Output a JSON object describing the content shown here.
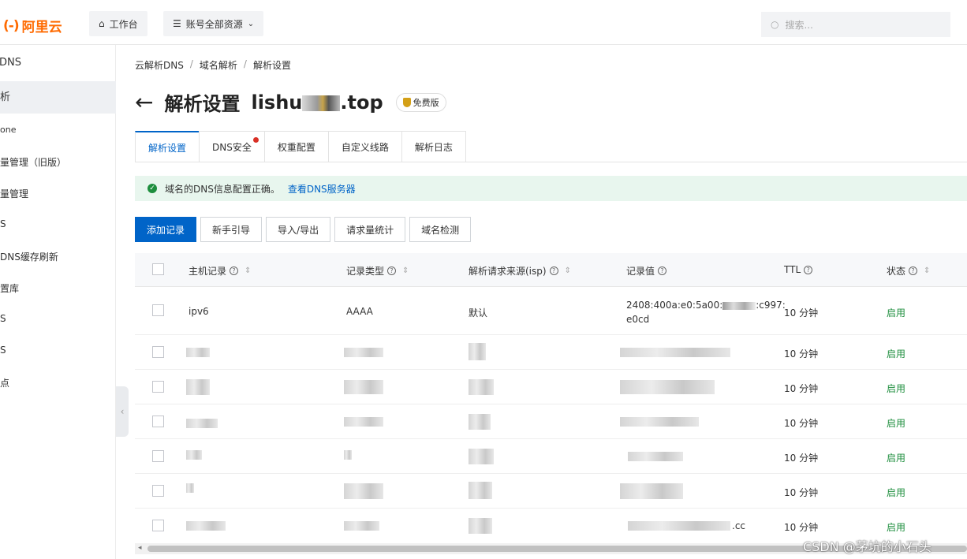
{
  "topbar": {
    "logo_mark": "(-)",
    "logo_text": "阿里云",
    "workbench_label": "工作台",
    "resources_label": "账号全部资源",
    "search_placeholder": "搜索..."
  },
  "sidebar": {
    "items": [
      {
        "label": "DNS"
      },
      {
        "label": "析"
      },
      {
        "label": "one"
      },
      {
        "label": "量管理（旧版）"
      },
      {
        "label": "量管理"
      },
      {
        "label": "S"
      },
      {
        "label": "DNS缓存刷新"
      },
      {
        "label": "置库"
      },
      {
        "label": "S"
      },
      {
        "label": "S"
      },
      {
        "label": "点"
      }
    ]
  },
  "breadcrumb": [
    "云解析DNS",
    "域名解析",
    "解析设置"
  ],
  "breadcrumb_sep": "/",
  "page": {
    "back_glyph": "←",
    "title": "解析设置",
    "domain_prefix": "lishu",
    "domain_suffix": ".top",
    "badge": "免费版"
  },
  "tabs": [
    {
      "label": "解析设置",
      "active": true
    },
    {
      "label": "DNS安全",
      "dot": true
    },
    {
      "label": "权重配置"
    },
    {
      "label": "自定义线路"
    },
    {
      "label": "解析日志"
    }
  ],
  "alert": {
    "text": "域名的DNS信息配置正确。",
    "link": "查看DNS服务器"
  },
  "actions": {
    "add": "添加记录",
    "guide": "新手引导",
    "import_export": "导入/导出",
    "stats": "请求量统计",
    "check": "域名检测"
  },
  "table": {
    "headers": {
      "host": "主机记录",
      "type": "记录类型",
      "isp": "解析请求来源(isp)",
      "value": "记录值",
      "ttl": "TTL",
      "status": "状态"
    },
    "first_row": {
      "host": "ipv6",
      "type": "AAAA",
      "isp": "默认",
      "value_line1_prefix": "2408:400a:e0:5a00:",
      "value_line1_suffix": ":c997:",
      "value_line2": "e0cd",
      "ttl": "10 分钟",
      "status": "启用"
    },
    "rows": [
      {
        "ttl": "10 分钟",
        "status": "启用"
      },
      {
        "ttl": "10 分钟",
        "status": "启用"
      },
      {
        "ttl": "10 分钟",
        "status": "启用"
      },
      {
        "ttl": "10 分钟",
        "status": "启用"
      },
      {
        "ttl": "10 分钟",
        "status": "启用"
      },
      {
        "ttl": "10 分钟",
        "status": "启用",
        "value_suffix": ".cc"
      }
    ]
  },
  "watermark": "CSDN @茅坑的小石头",
  "colors": {
    "brand": "#ff6a00",
    "primary": "#0064c8",
    "success": "#1e8e3e",
    "danger": "#d93026"
  }
}
